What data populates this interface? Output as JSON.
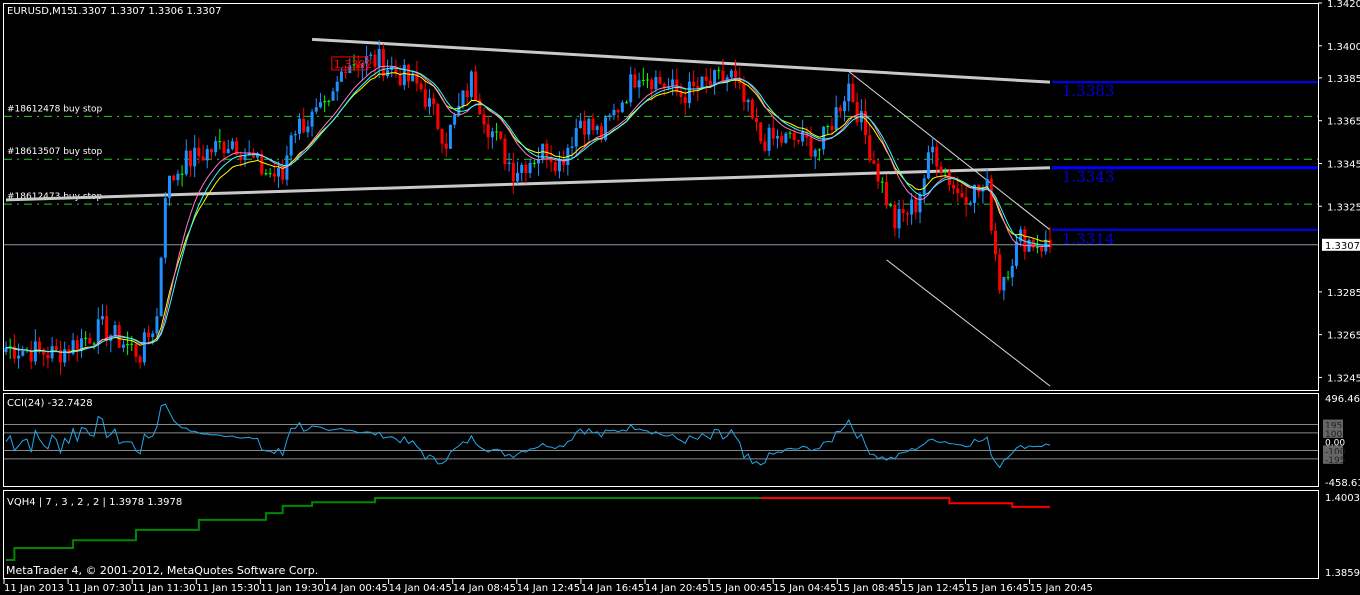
{
  "header": {
    "symbol": "EURUSD,M15",
    "ohlc": "1.3307 1.3307 1.3306 1.3307"
  },
  "copyright": "MetaTrader 4, © 2001-2012, MetaQuotes Software Corp.",
  "colors": {
    "bull": "#1e90ff",
    "bear": "#ff0000",
    "doji": "#00ff00",
    "ma_slow": "#ffff00",
    "ma_pink": "#ff77cc",
    "ma_cyan": "#33ffff",
    "order_line": "#22cc22",
    "level_line": "#0000ff",
    "cci": "#22aaee",
    "vqh_up": "#008800",
    "vqh_down": "#ff0000"
  },
  "orders": [
    {
      "label": "#18612478 buy stop",
      "price": 1.3367
    },
    {
      "label": "#18613507 buy stop",
      "price": 1.3347
    },
    {
      "label": "#18612473 buy stop",
      "price": 1.3326
    }
  ],
  "levels": [
    {
      "label": "1.3383",
      "price": 1.3383
    },
    {
      "label": "1.3343",
      "price": 1.3343
    },
    {
      "label": "1.3314",
      "price": 1.3314
    }
  ],
  "price_marker": "1.3392",
  "chart_data": {
    "type": "candlestick",
    "title": "EURUSD,M15",
    "bars": 250,
    "ylim": [
      1.3241,
      1.342
    ],
    "price_ticks": [
      "1.3420",
      "1.3400",
      "1.3385",
      "1.3365",
      "1.3345",
      "1.3325",
      "1.3285",
      "1.3265",
      "1.3245"
    ],
    "current_price": "1.3307",
    "time_ticks": [
      "11 Jan 2013",
      "11 Jan 07:30",
      "11 Jan 11:30",
      "11 Jan 15:30",
      "11 Jan 19:30",
      "14 Jan 00:45",
      "14 Jan 04:45",
      "14 Jan 08:45",
      "14 Jan 12:45",
      "14 Jan 16:45",
      "14 Jan 20:45",
      "15 Jan 00:45",
      "15 Jan 04:45",
      "15 Jan 08:45",
      "15 Jan 12:45",
      "15 Jan 16:45",
      "15 Jan 20:45"
    ],
    "close_anchors": [
      [
        0,
        1.3259
      ],
      [
        12,
        1.3256
      ],
      [
        23,
        1.3268
      ],
      [
        32,
        1.3256
      ],
      [
        36,
        1.3273
      ],
      [
        38,
        1.3333
      ],
      [
        42,
        1.3345
      ],
      [
        54,
        1.3356
      ],
      [
        61,
        1.3342
      ],
      [
        66,
        1.3338
      ],
      [
        68,
        1.3361
      ],
      [
        77,
        1.337
      ],
      [
        81,
        1.3393
      ],
      [
        89,
        1.3393
      ],
      [
        99,
        1.338
      ],
      [
        105,
        1.3356
      ],
      [
        111,
        1.3384
      ],
      [
        115,
        1.3363
      ],
      [
        121,
        1.3342
      ],
      [
        129,
        1.3352
      ],
      [
        132,
        1.3345
      ],
      [
        137,
        1.3366
      ],
      [
        142,
        1.3358
      ],
      [
        151,
        1.3389
      ],
      [
        161,
        1.3377
      ],
      [
        173,
        1.3386
      ],
      [
        180,
        1.3356
      ],
      [
        189,
        1.3356
      ],
      [
        194,
        1.3352
      ],
      [
        201,
        1.3382
      ],
      [
        206,
        1.3352
      ],
      [
        212,
        1.3317
      ],
      [
        217,
        1.3326
      ],
      [
        221,
        1.3352
      ],
      [
        227,
        1.3331
      ],
      [
        234,
        1.3333
      ],
      [
        237,
        1.3289
      ],
      [
        242,
        1.331
      ],
      [
        249,
        1.3306
      ]
    ],
    "trendlines": [
      {
        "from": [
          73,
          1.3403
        ],
        "to": [
          249,
          1.3383
        ],
        "kind": "thick-grey"
      },
      {
        "from": [
          0,
          1.3328
        ],
        "to": [
          249,
          1.3343
        ],
        "kind": "thick-grey"
      },
      {
        "from": [
          201,
          1.3388
        ],
        "to": [
          249,
          1.3314
        ],
        "kind": "thin"
      },
      {
        "from": [
          210,
          1.33
        ],
        "to": [
          249,
          1.3241
        ],
        "kind": "thin"
      }
    ],
    "cci": {
      "label": "CCI(24) -32.7428",
      "period": 24,
      "max": "496.4614",
      "min": "-458.613",
      "range": [
        -458.613,
        496.4614
      ],
      "levels": [
        "195",
        "100",
        "0.00",
        "-100",
        "-195"
      ]
    },
    "vqh": {
      "label": "VQH4 | 7 , 3 , 2 , 2 | 1.3978 1.3978",
      "max": "1.4003",
      "min": "1.3859",
      "range": [
        1.3859,
        1.4003
      ],
      "up_steps": [
        [
          0,
          1.3882
        ],
        [
          2,
          1.3905
        ],
        [
          16,
          1.392
        ],
        [
          31,
          1.394
        ],
        [
          46,
          1.3959
        ],
        [
          62,
          1.3972
        ],
        [
          66,
          1.3986
        ],
        [
          73,
          1.3993
        ],
        [
          88,
          1.4001
        ],
        [
          180,
          1.4001
        ]
      ],
      "down_steps": [
        [
          180,
          1.4001
        ],
        [
          225,
          1.3991
        ],
        [
          240,
          1.3984
        ],
        [
          249,
          1.3984
        ]
      ]
    }
  }
}
